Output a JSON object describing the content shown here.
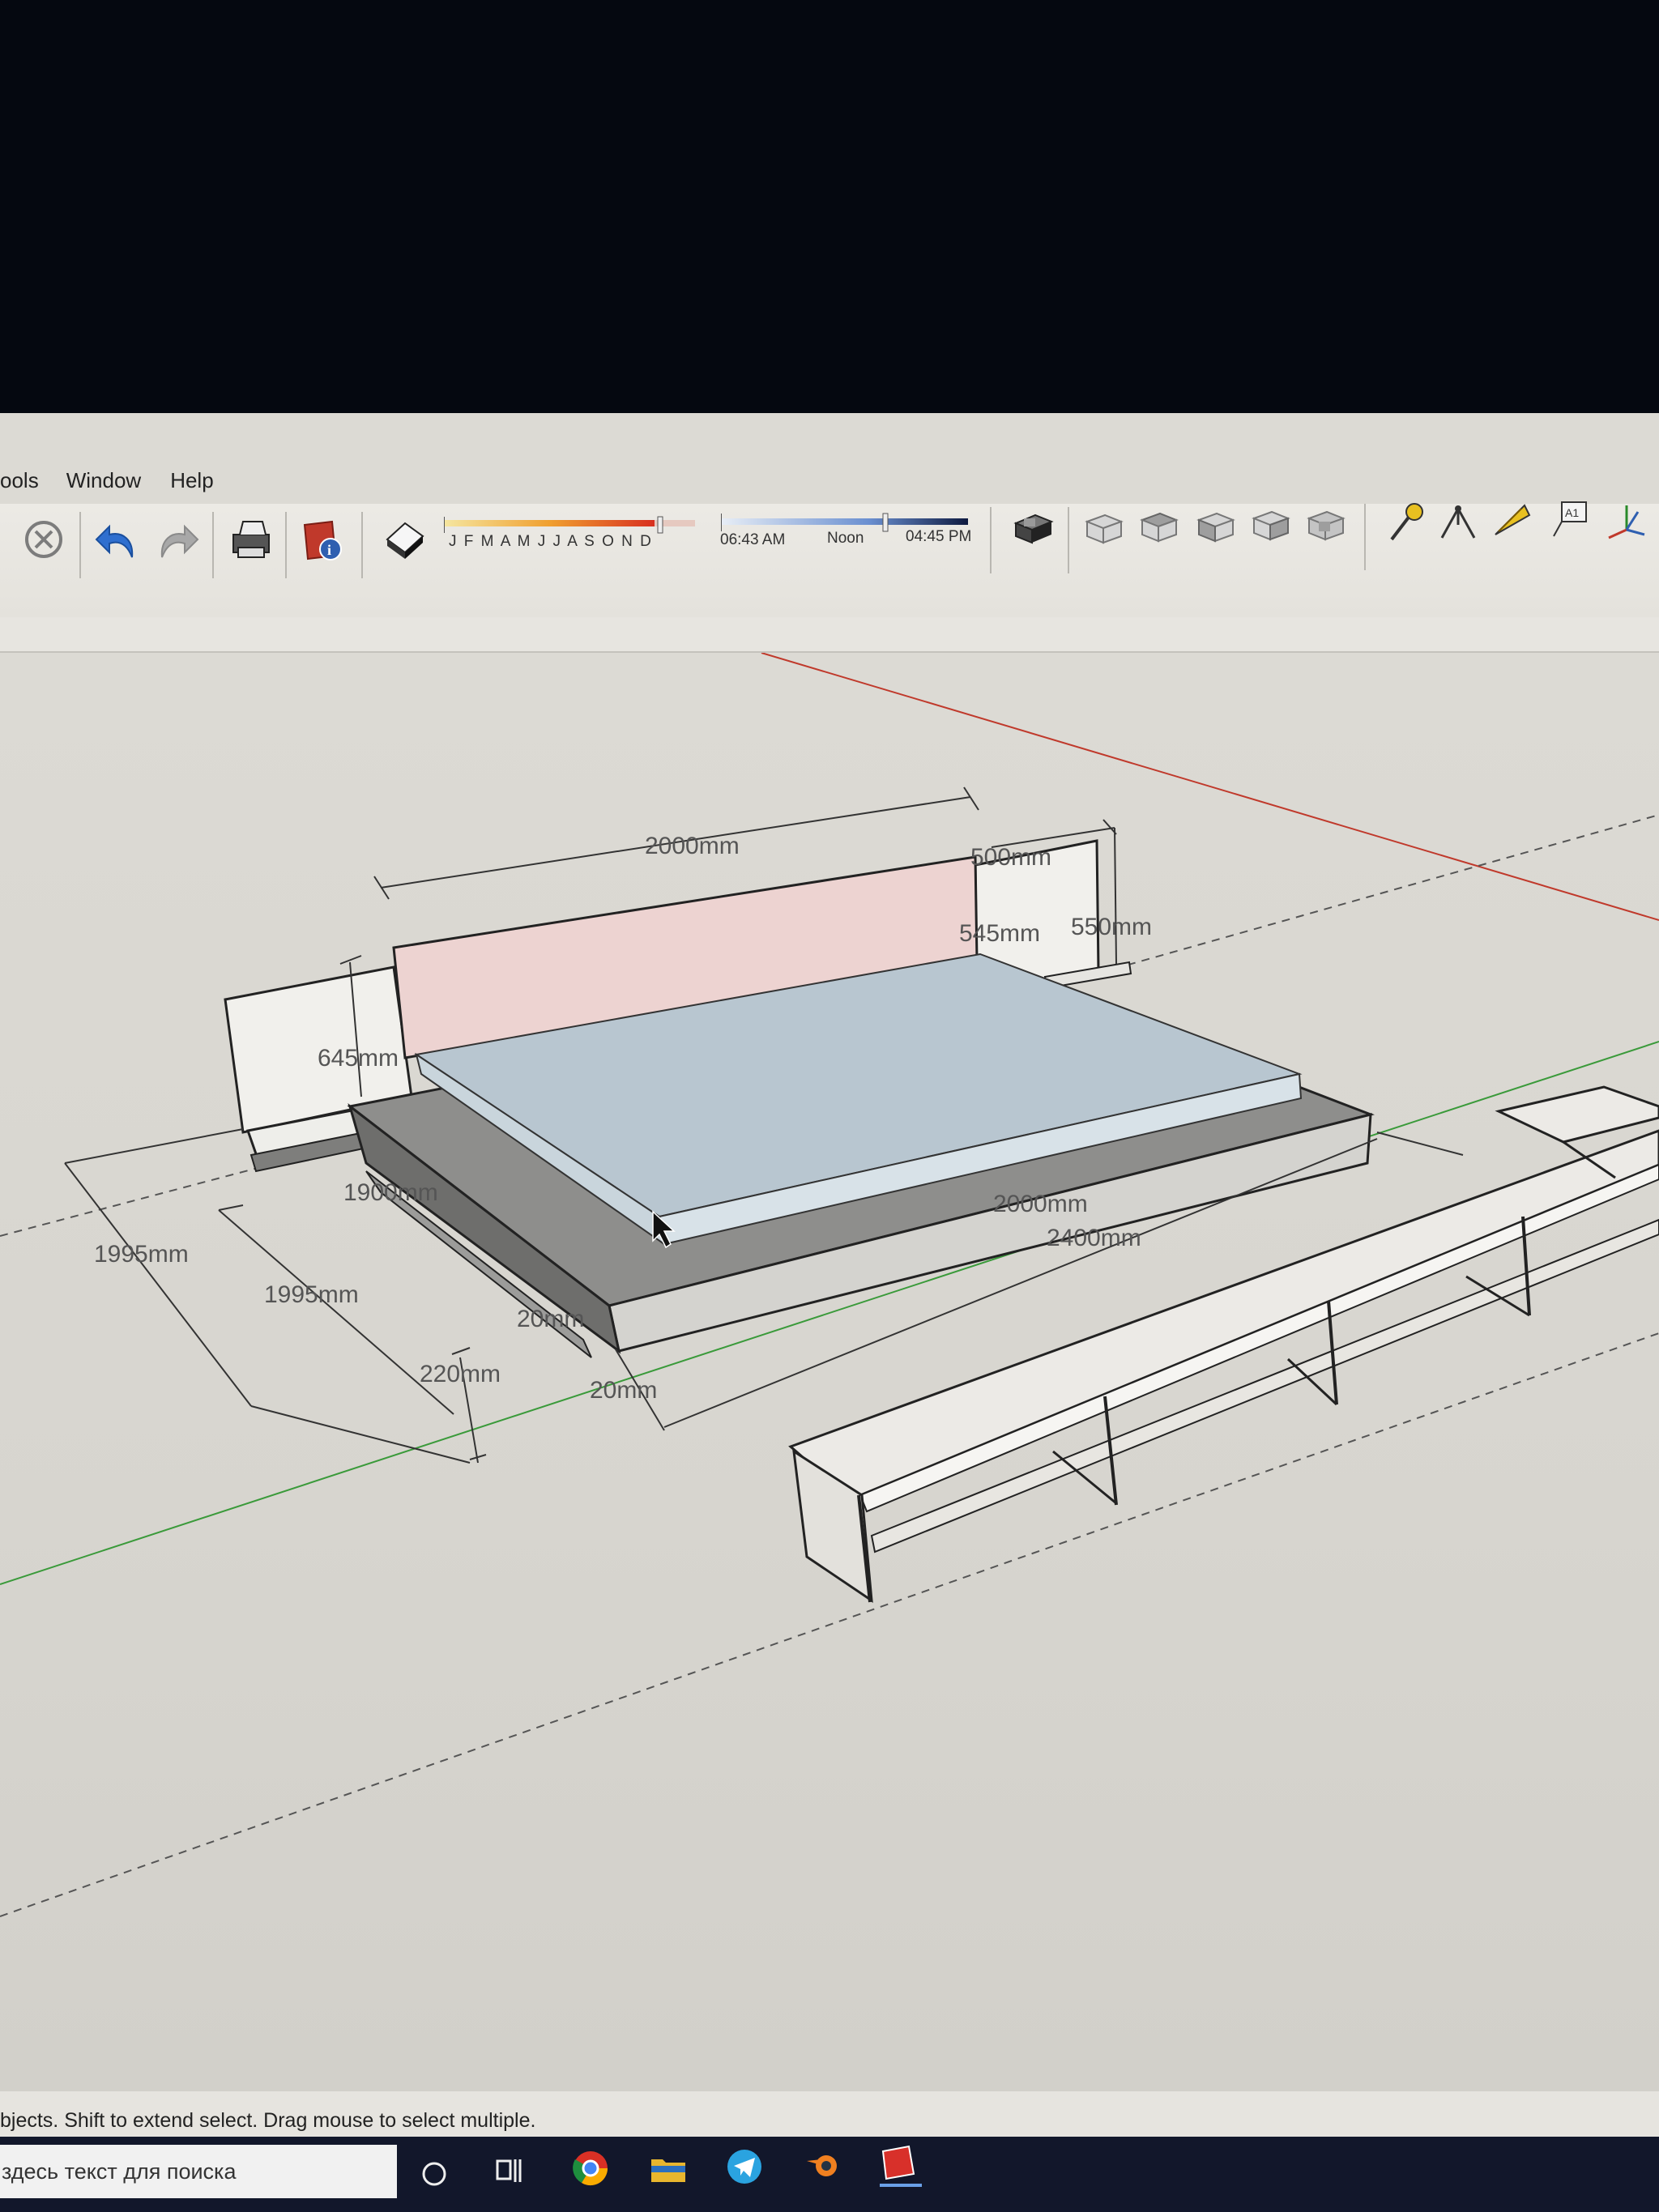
{
  "menu": {
    "tools_label": "ools",
    "window_label": "Window",
    "help_label": "Help"
  },
  "shadow_settings": {
    "months_label": "J F M A M J J A S O N D",
    "time_start": "06:43 AM",
    "time_mid": "Noon",
    "time_end": "04:45 PM"
  },
  "dimensions": {
    "headboard_width": "2000mm",
    "nightstand_width": "500mm",
    "headboard_height_right": "545mm",
    "nightstand_height": "550mm",
    "headboard_height_left": "645mm",
    "mattress_width": "1900mm",
    "outer_depth_1": "1995mm",
    "outer_depth_2": "1995mm",
    "base_height": "220mm",
    "thickness_1": "20mm",
    "thickness_2": "20mm",
    "mattress_length": "2000mm",
    "frame_length": "2400mm"
  },
  "status": {
    "text": "bjects. Shift to extend select. Drag mouse to select multiple."
  },
  "taskbar": {
    "search_placeholder": "здесь текст для поиска"
  },
  "colors": {
    "headboard": "#edd3d1",
    "mattress": "#b8c6d0",
    "frame": "#8e8e8c",
    "red_axis": "#c0392b",
    "green_axis": "#3a9a3a"
  }
}
